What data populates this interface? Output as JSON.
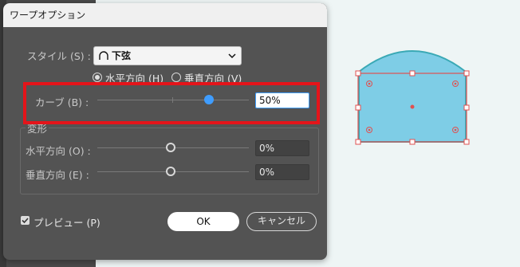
{
  "dialog": {
    "title": "ワープオプション",
    "style_label": "スタイル (S) :",
    "style_value": "下弦",
    "orientation": {
      "horizontal_label": "水平方向 (H)",
      "vertical_label": "垂直方向 (V)",
      "selected": "horizontal"
    },
    "bend_label": "カーブ (B) :",
    "bend_value": "50%",
    "distortion_label": "変形",
    "horizontal_distort_label": "水平方向 (O) :",
    "horizontal_distort_value": "0%",
    "vertical_distort_label": "垂直方向 (E) :",
    "vertical_distort_value": "0%",
    "preview_label": "プレビュー (P)",
    "preview_checked": true,
    "ok_label": "OK",
    "cancel_label": "キャンセル"
  },
  "colors": {
    "dialog_bg": "#535353",
    "accent_blue": "#3f9dff",
    "highlight_red": "#e4141a",
    "shape_fill": "#7ecde6",
    "shape_stroke": "#e05050"
  },
  "icons": {
    "style_arc": "lower-arc-icon",
    "dropdown": "chevron-down-icon",
    "checkbox": "check-icon"
  }
}
